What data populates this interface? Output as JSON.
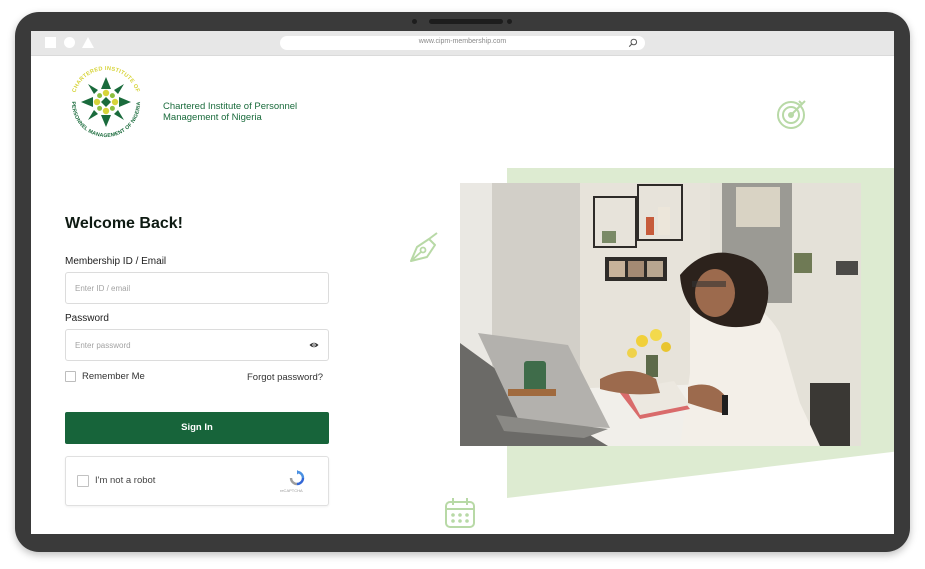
{
  "browser": {
    "url": "www.cipm-membership.com"
  },
  "brand": {
    "logo_text_top": "CHARTERED INSTITUTE OF",
    "logo_text_bottom": "PERSONNEL MANAGEMENT OF NIGERIA",
    "org_name_line1": "Chartered Institute of Personnel",
    "org_name_line2": "Management of Nigeria"
  },
  "form": {
    "title": "Welcome Back!",
    "id_label": "Membership ID / Email",
    "id_placeholder": "Enter ID / email",
    "password_label": "Password",
    "password_placeholder": "Enter password",
    "remember_label": "Remember Me",
    "forgot_label": "Forgot password?",
    "submit_label": "Sign In"
  },
  "captcha": {
    "label": "I'm not a robot",
    "brand": "reCAPTCHA"
  },
  "icons": {
    "search": "search-icon",
    "eye": "eye-icon",
    "target": "target-icon",
    "pen": "pen-nib-icon",
    "calendar": "calendar-icon",
    "recaptcha": "recaptcha-icon"
  },
  "colors": {
    "brand_green": "#17643a",
    "light_green": "#ddebd1",
    "deco_green": "#b8d9a6",
    "logo_yellow": "#d7d43a"
  }
}
